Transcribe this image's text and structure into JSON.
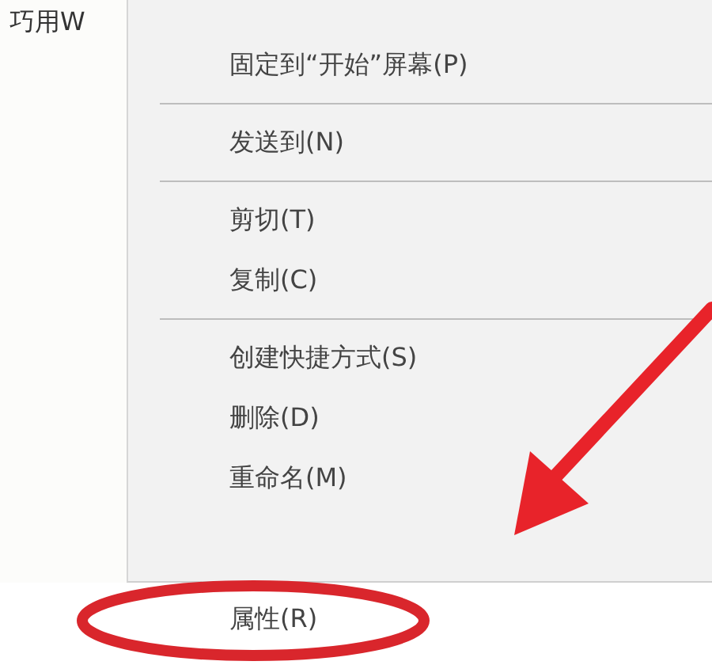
{
  "file_label": "巧用W",
  "menu": {
    "items": [
      {
        "kind": "item",
        "label": "固定到“开始”屏幕(P)"
      },
      {
        "kind": "separator"
      },
      {
        "kind": "item",
        "label": "发送到(N)"
      },
      {
        "kind": "separator"
      },
      {
        "kind": "item",
        "label": "剪切(T)"
      },
      {
        "kind": "item",
        "label": "复制(C)"
      },
      {
        "kind": "separator"
      },
      {
        "kind": "item",
        "label": "创建快捷方式(S)"
      },
      {
        "kind": "item",
        "label": "删除(D)"
      },
      {
        "kind": "item",
        "label": "重命名(M)"
      }
    ]
  },
  "highlighted_item": {
    "label": "属性(R)"
  }
}
